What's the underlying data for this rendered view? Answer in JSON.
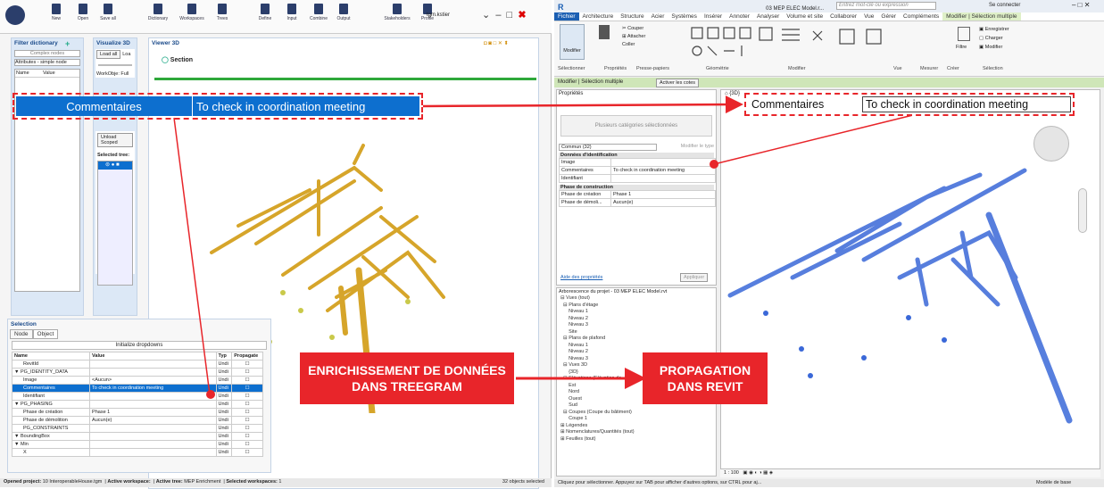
{
  "left": {
    "toolbar": [
      "New",
      "Open",
      "Save all",
      "Dictionary",
      "Workspaces",
      "Trees",
      "Define",
      "Input",
      "Combine",
      "Output",
      "Stakeholders",
      "Profile"
    ],
    "user": "tgm.kstier",
    "filter": {
      "title": "Filter dictionary",
      "type": "Complex nodes",
      "select": "Attributes - simple node",
      "col_name": "Name",
      "col_value": "Value"
    },
    "visualize": {
      "title": "Visualize 3D",
      "load_all": "Load all",
      "load_tab": "Loa",
      "work": "WorkObje:",
      "full": "Full",
      "unload": "Unload Scoped",
      "selected": "Selected tree:"
    },
    "viewer": {
      "title": "Viewer 3D",
      "section": "Section"
    },
    "selection": {
      "title": "Selection",
      "tab_node": "Node",
      "tab_object": "Object",
      "init": "Initialize dropdowns",
      "headers": [
        "Name",
        "Value",
        "Typ",
        "Propagate"
      ],
      "rows": [
        [
          "RevitId",
          "",
          "Undi"
        ],
        [
          "▼ PG_IDENTITY_DATA",
          "",
          "Undi"
        ],
        [
          "Image",
          "<Aucun>",
          "Undi"
        ],
        [
          "Commentaires",
          "To check in coordination meeting",
          "Undi"
        ],
        [
          "Identifiant",
          "",
          "Undi"
        ],
        [
          "▼ PG_PHASING",
          "",
          "Undi"
        ],
        [
          "Phase de création",
          "Phase 1",
          "Undi"
        ],
        [
          "Phase de démolition",
          "Aucun(e)",
          "Undi"
        ],
        [
          "PG_CONSTRAINTS",
          "",
          "Undi"
        ],
        [
          "▼ BoundingBox",
          "",
          "Undi"
        ],
        [
          "▼ Min",
          "",
          "Undi"
        ],
        [
          "X",
          "",
          "Undi"
        ]
      ]
    },
    "status": {
      "project_label": "Opened project:",
      "project": "10 InteroperableHouse.tgm",
      "ws_label": "Active workspace:",
      "tree_label": "Active tree:",
      "tree": "MEP Enrichment",
      "sel_ws_label": "Selected workspaces:",
      "sel_ws": "1",
      "objects": "32 objects selected"
    }
  },
  "right": {
    "title": "03 MEP ELEC Model.r...",
    "search": "Entrez mot-clé ou expression",
    "connect": "Se connecter",
    "tabs": [
      "Fichier",
      "Architecture",
      "Structure",
      "Acier",
      "Systèmes",
      "Insérer",
      "Annoter",
      "Analyser",
      "Volume et site",
      "Collaborer",
      "Vue",
      "Gérer",
      "Compléments",
      "Modifier | Sélection multiple"
    ],
    "ribbon": {
      "modify": "Modifier",
      "groups": [
        "Sélectionner",
        "Propriétés",
        "Presse-papiers",
        "Géométrie",
        "Modifier",
        "Vue",
        "Mesurer",
        "Créer",
        "Sélection"
      ],
      "cut": "Couper",
      "attach": "Attacher",
      "coller": "Coller",
      "filtre": "Filtre",
      "enregistrer": "Enregistrer",
      "charger": "Charger",
      "modifier2": "Modifier"
    },
    "ctx": {
      "label": "Modifier | Sélection multiple",
      "btn": "Activer les cotes"
    },
    "props": {
      "title": "Propriétés",
      "multi": "Plusieurs catégories sélectionnées",
      "common": "Commun (32)",
      "edit_type": "Modifier le type",
      "g1": "Données d'identification",
      "rows1": [
        [
          "Image",
          ""
        ],
        [
          "Commentaires",
          "To check in coordination meeting"
        ],
        [
          "Identifiant",
          ""
        ]
      ],
      "g2": "Phase de construction",
      "rows2": [
        [
          "Phase de création",
          "Phase 1"
        ],
        [
          "Phase de démoli...",
          "Aucun(e)"
        ]
      ],
      "help": "Aide des propriétés",
      "apply": "Appliquer"
    },
    "view_tab": "{3D}",
    "browser": {
      "title": "Arborescence du projet - 03 MEP ELEC Model.rvt",
      "items": [
        "⊟ Vues (tout)",
        "  ⊟ Plans d'étage",
        "      Niveau 1",
        "      Niveau 2",
        "      Niveau 3",
        "      Site",
        "  ⊟ Plans de plafond",
        "      Niveau 1",
        "      Niveau 2",
        "      Niveau 3",
        "  ⊟ Vues 3D",
        "      {3D}",
        "  ⊟ Elévations (Elévation de ...",
        "      Est",
        "      Nord",
        "      Ouest",
        "      Sud",
        "  ⊟ Coupes (Coupe du bâtiment)",
        "      Coupe 1",
        "⊞ Légendes",
        "⊞ Nomenclatures/Quantités (tout)",
        "⊞ Feuilles (tout)"
      ]
    },
    "scale": "1 : 100",
    "status": "Cliquez pour sélectionner. Appuyez sur TAB pour afficher d'autres options, sur CTRL pour aj...",
    "model": "Modèle de base"
  },
  "banner_left": {
    "key": "Commentaires",
    "value": "To check in coordination meeting"
  },
  "banner_right": {
    "key": "Commentaires",
    "value": "To check in coordination meeting"
  },
  "callout_left": "ENRICHISSEMENT DE DONNÉES DANS TREEGRAM",
  "callout_right": "PROPAGATION DANS REVIT",
  "colors": {
    "accent": "#e8252a",
    "treegram_blue": "#0d6fcf",
    "revit_blue": "#3a68d8",
    "orange": "#d6a52a"
  }
}
